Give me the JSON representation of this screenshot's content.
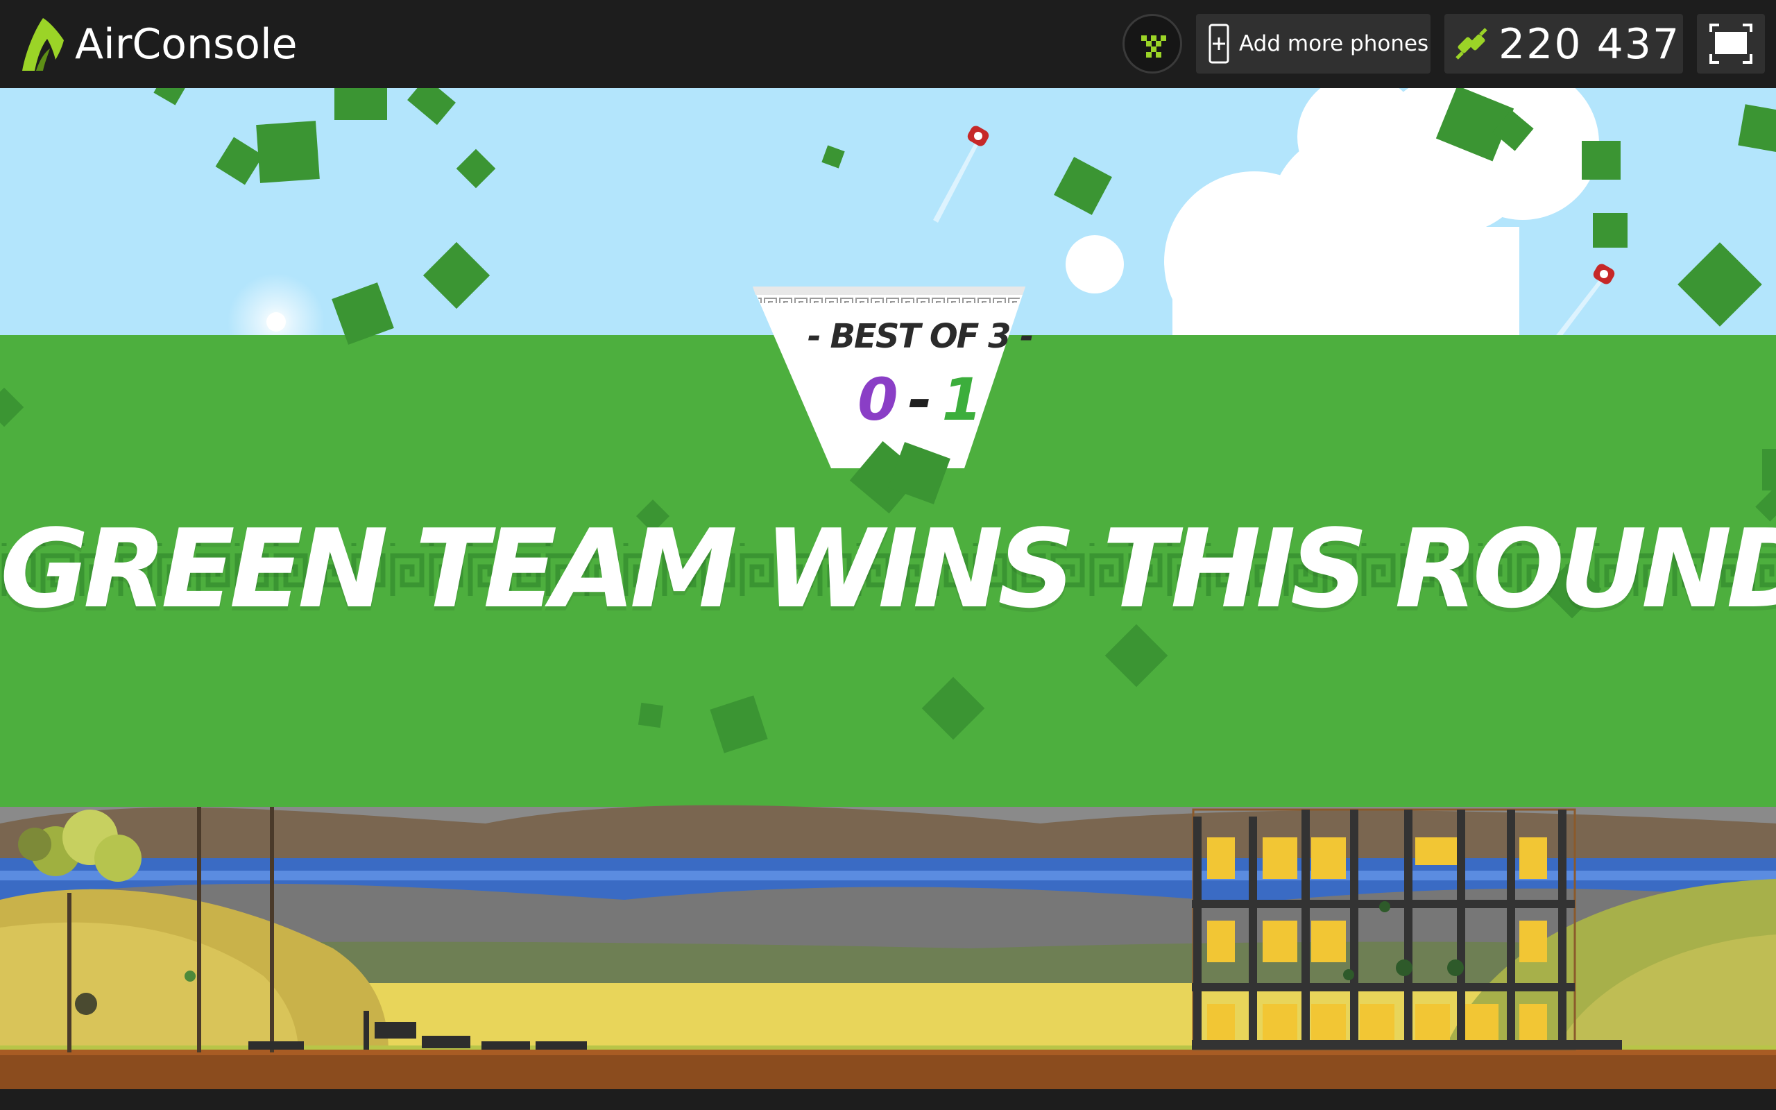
{
  "app": {
    "brand": "AirConsole",
    "add_phones_label": "Add more phones",
    "connect_code": "220 437"
  },
  "icons": {
    "logo": "airconsole-logo-icon",
    "controller": "controller-icon",
    "phone": "phone-plus-icon",
    "connect": "link-icon",
    "fullscreen": "fullscreen-icon"
  },
  "colors": {
    "topbar": "#1d1d1d",
    "sky": "#b3e5fc",
    "banner_green": "#4daf3e",
    "square_green": "#3b9533",
    "purple_score": "#8a3ec6",
    "green_score": "#3cae3c",
    "brand_accent": "#9bd427"
  },
  "game": {
    "match_label": "- BEST OF 3 -",
    "score_purple": "0",
    "score_separator": "-",
    "score_green": "1",
    "round_message": "GREEN TEAM WINS THIS ROUND!"
  }
}
